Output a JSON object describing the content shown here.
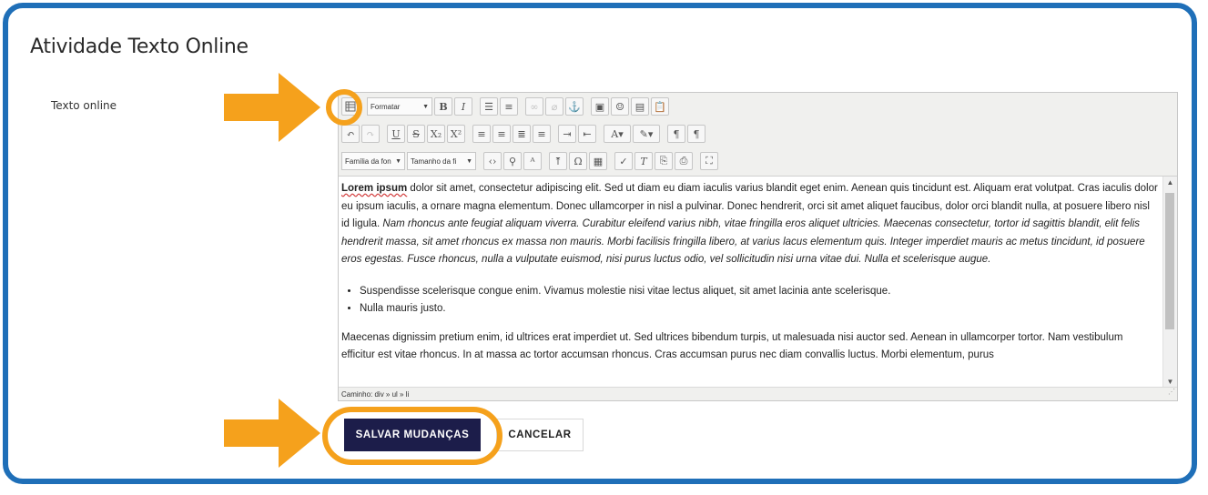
{
  "page": {
    "title": "Atividade Texto Online",
    "field_label": "Texto online"
  },
  "editor": {
    "toolbar": {
      "row1": {
        "format_select": "Formatar"
      },
      "row3": {
        "font_family_select": "Família da fon",
        "font_size_select": "Tamanho da fi"
      }
    },
    "content": {
      "paragraph1_bold": "Lorem ipsum",
      "paragraph1_a": " dolor sit amet, consectetur adipiscing elit. Sed ut diam eu diam iaculis varius blandit eget enim. Aenean quis tincidunt est. Aliquam erat volutpat. Cras iaculis dolor eu ipsum iaculis, a ornare magna elementum. Donec ullamcorper in nisl a pulvinar. Donec hendrerit, orci sit amet aliquet faucibus, dolor orci blandit nulla, at posuere libero nisl id ligula. ",
      "paragraph1_italic": "Nam rhoncus ante feugiat aliquam viverra. Curabitur eleifend varius nibh, vitae fringilla eros aliquet ultricies. Maecenas consectetur, tortor id sagittis blandit, elit felis hendrerit massa, sit amet rhoncus ex massa non mauris. Morbi facilisis fringilla libero, at varius lacus elementum quis. Integer imperdiet mauris ac metus tincidunt, id posuere eros egestas. Fusce rhoncus, nulla a vulputate euismod, nisi purus luctus odio, vel sollicitudin nisi urna vitae dui. Nulla et scelerisque augue.",
      "list_items": [
        "Suspendisse scelerisque congue enim. Vivamus molestie nisi vitae lectus aliquet, sit amet lacinia ante scelerisque.",
        "Nulla mauris justo."
      ],
      "paragraph2": "Maecenas dignissim pretium enim, id ultrices erat imperdiet ut. Sed ultrices bibendum turpis, ut malesuada nisi auctor sed. Aenean in ullamcorper tortor. Nam vestibulum efficitur est vitae rhoncus. In at massa ac tortor accumsan rhoncus. Cras accumsan purus nec diam convallis luctus. Morbi elementum, purus"
    },
    "status_path": "Caminho: div » ul » li"
  },
  "actions": {
    "save_label": "SALVAR MUDANÇAS",
    "cancel_label": "CANCELAR"
  },
  "colors": {
    "frame": "#1f6fb8",
    "highlight": "#f5a11c",
    "primary_button": "#1c1d4a"
  }
}
